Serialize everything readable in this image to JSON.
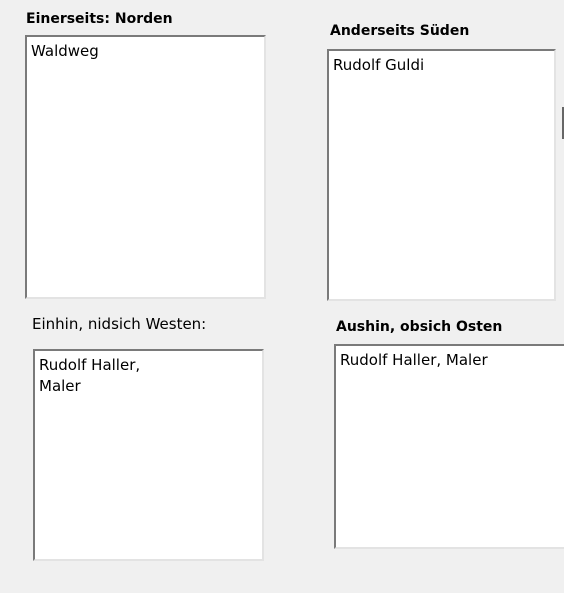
{
  "fields": {
    "north": {
      "label": "Einerseits: Norden",
      "value": "Waldweg"
    },
    "south": {
      "label": "Anderseits Süden",
      "value": "Rudolf Guldi"
    },
    "west": {
      "label": "Einhin, nidsich Westen:",
      "value": "Rudolf Haller,\nMaler"
    },
    "east": {
      "label": "Aushin,  obsich Osten",
      "value": "Rudolf Haller, Maler"
    }
  }
}
